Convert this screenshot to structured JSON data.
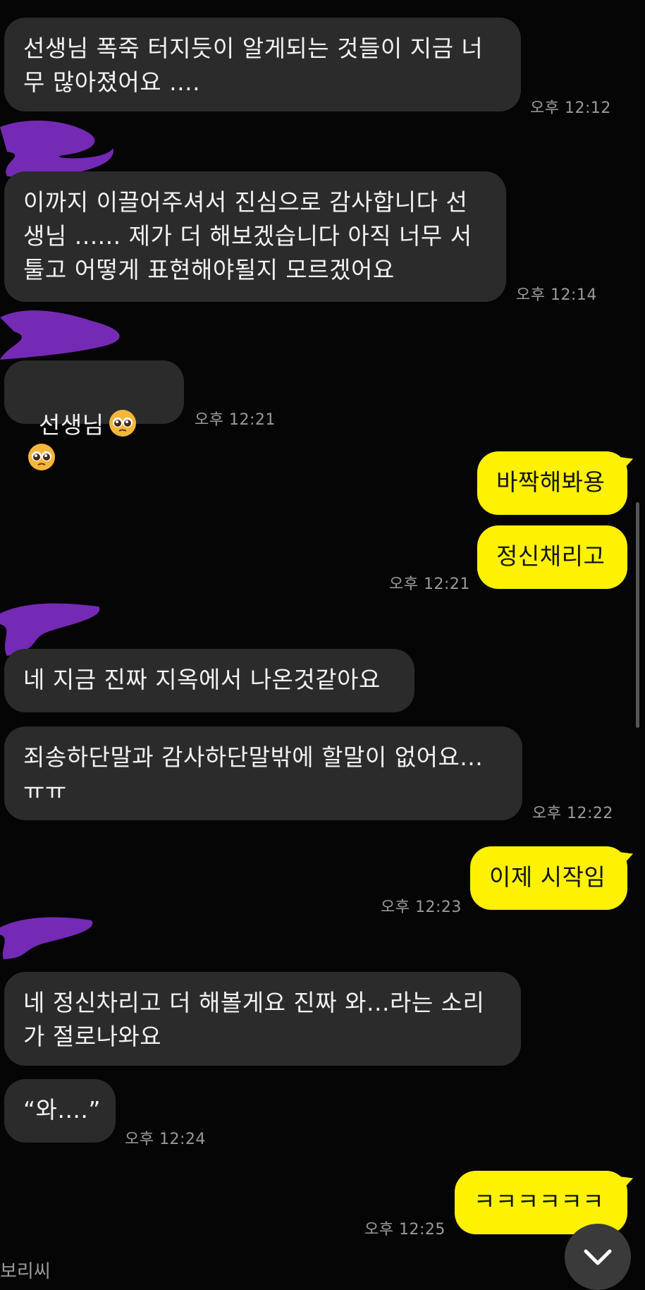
{
  "messages": [
    {
      "dir": "in",
      "text": "선생님 폭죽 터지듯이 알게되는 것들이 지금 너\n무 많아졌어요 ....",
      "time": "오후 12:12"
    },
    {
      "dir": "in",
      "text": "이까지 이끌어주셔서 진심으로 감사합니다 선\n생님 ...... 제가 더 해보겠습니다 아직 너무 서\n툴고 어떻게 표현해야될지 모르겠어요",
      "time": "오후 12:14"
    },
    {
      "dir": "in",
      "text": "선생님",
      "emoji": "pleading-face",
      "time": "오후 12:21"
    },
    {
      "dir": "out",
      "text": "바짝해봐용",
      "time": ""
    },
    {
      "dir": "out",
      "text": "정신채리고",
      "time": "오후 12:21"
    },
    {
      "dir": "in",
      "text": "네 지금 진짜 지옥에서 나온것같아요",
      "time": ""
    },
    {
      "dir": "in",
      "text": "죄송하단말과 감사하단말밖에 할말이 없어요...\nㅠㅠ",
      "time": "오후 12:22"
    },
    {
      "dir": "out",
      "text": "이제 시작임",
      "time": "오후 12:23"
    },
    {
      "dir": "in",
      "text": "네 정신차리고 더 해볼게요 진짜 와...라는 소리\n가 절로나와요",
      "time": ""
    },
    {
      "dir": "in",
      "text": "“와....”",
      "time": "오후 12:24"
    },
    {
      "dir": "out",
      "text": "ㅋㅋㅋㅋㅋㅋ",
      "time": "오후 12:25"
    }
  ],
  "partial_text": "보리씨",
  "colors": {
    "background": "#050505",
    "incoming": "#2b2b2b",
    "outgoing": "#fff200",
    "redaction": "#7b2cbf"
  },
  "icons": {
    "scroll_down": "chevron-down-icon",
    "emoji": "pleading-face"
  }
}
